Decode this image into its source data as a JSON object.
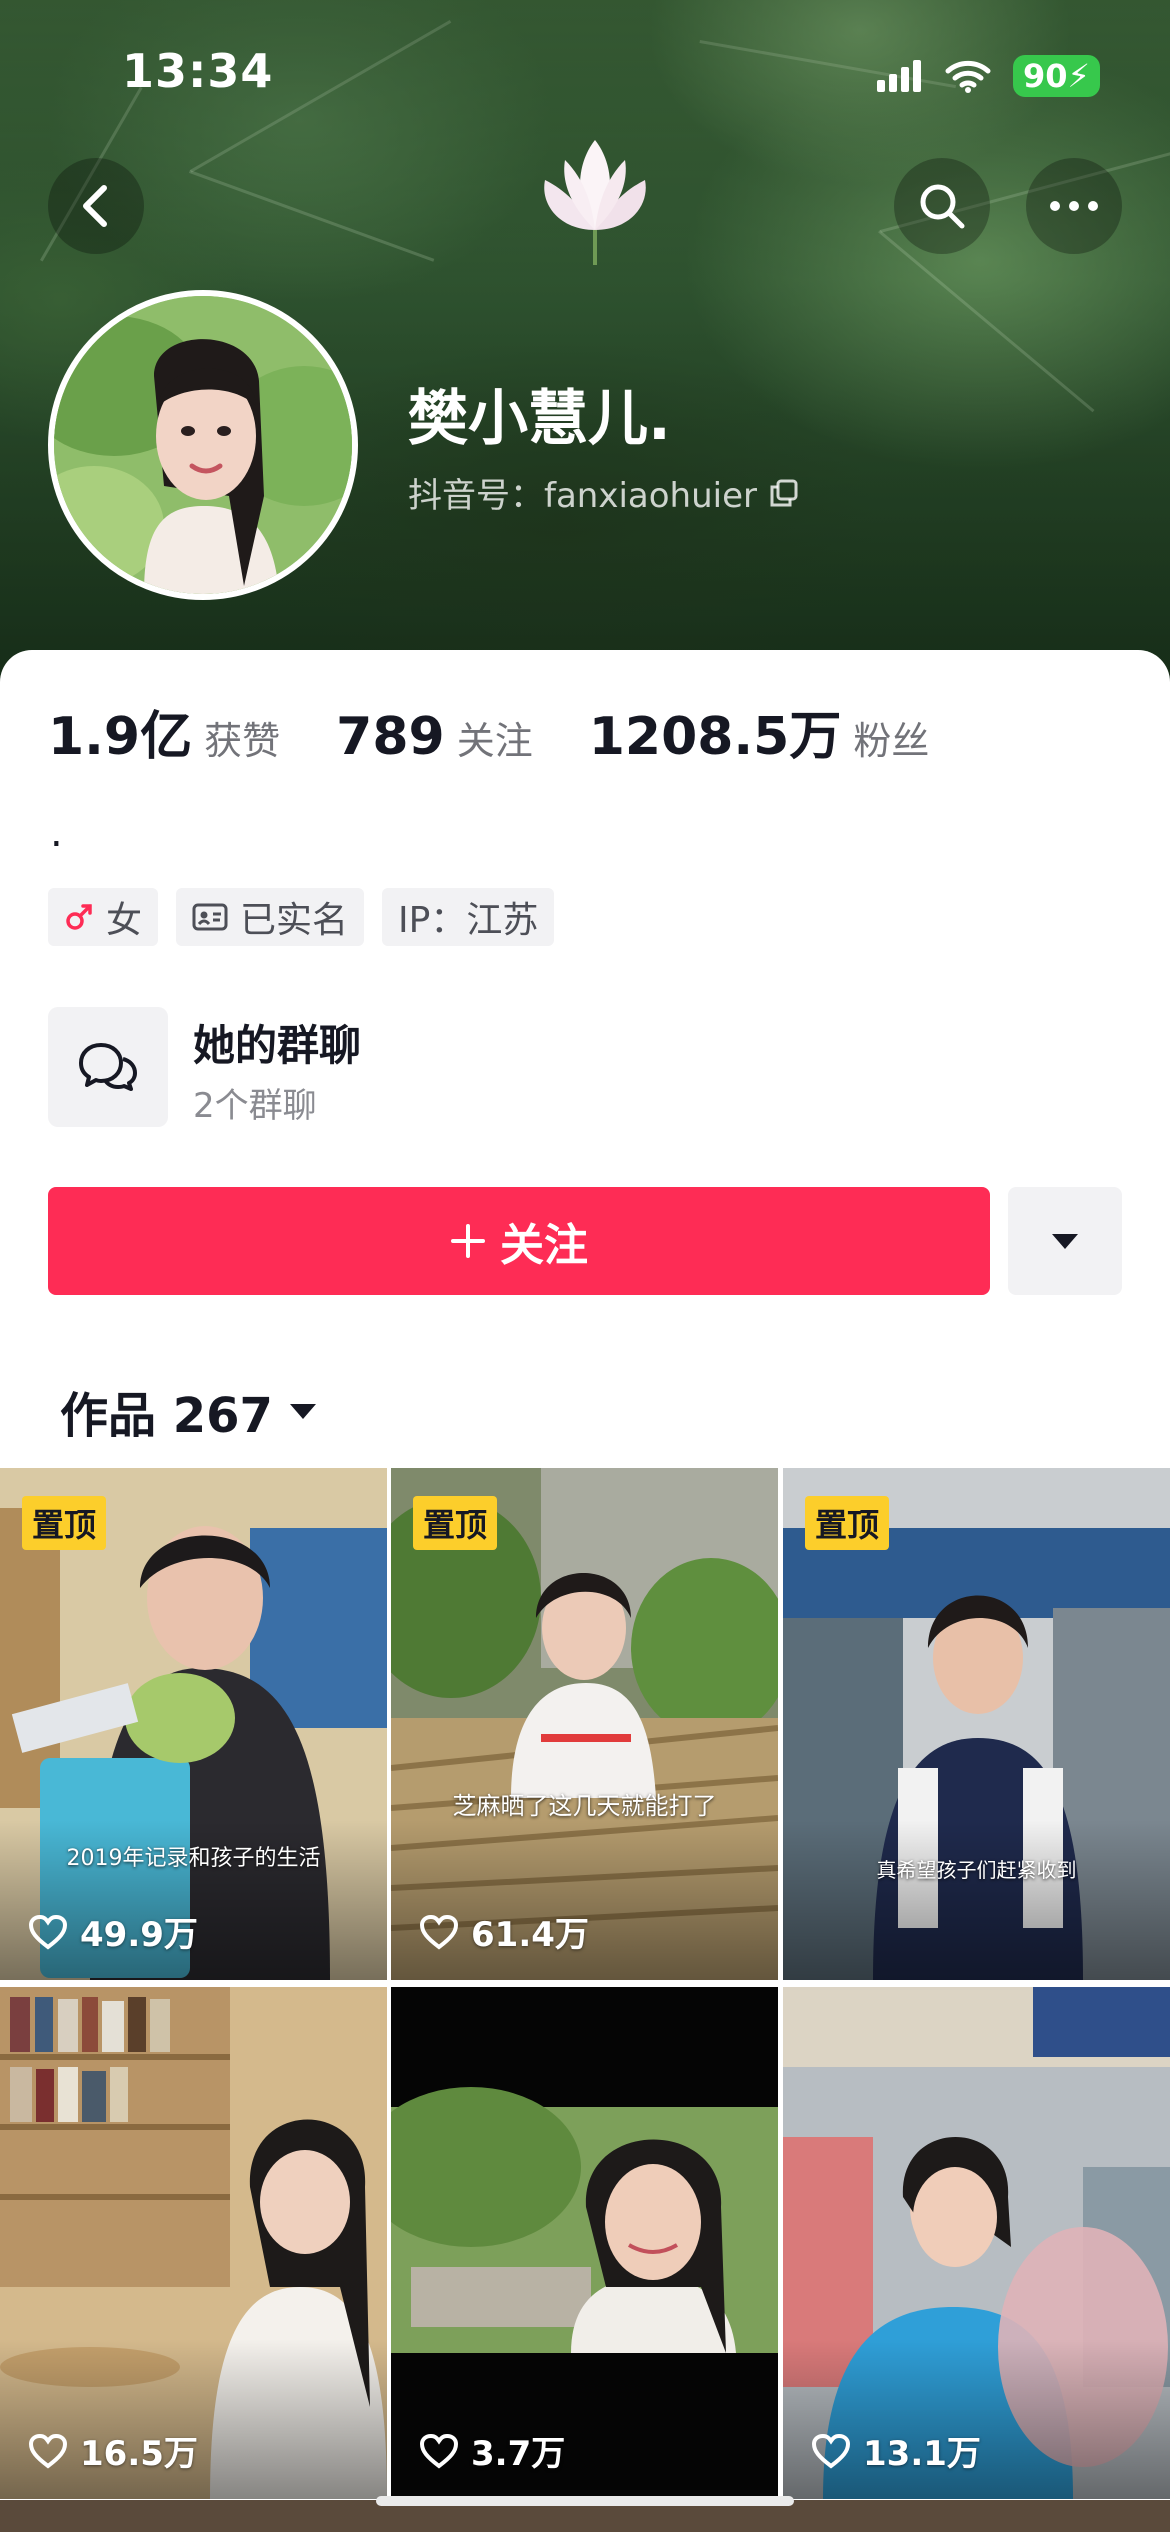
{
  "status_bar": {
    "time": "13:34",
    "battery": "90"
  },
  "profile": {
    "nickname": "樊小慧儿.",
    "douyin_id": "抖音号：fanxiaohuier",
    "bio": "."
  },
  "stats": [
    {
      "value": "1.9亿",
      "label": "获赞"
    },
    {
      "value": "789",
      "label": "关注"
    },
    {
      "value": "1208.5万",
      "label": "粉丝"
    }
  ],
  "tags": {
    "gender": "女",
    "verified": "已实名",
    "ip": "IP：江苏"
  },
  "group_chat": {
    "title": "她的群聊",
    "subtitle": "2个群聊"
  },
  "follow_button": {
    "label": "关注"
  },
  "works_tab": {
    "label": "作品 267"
  },
  "videos": [
    {
      "pinned": "置顶",
      "likes": "49.9万",
      "caption": "2019年记录和孩子的生活"
    },
    {
      "pinned": "置顶",
      "likes": "61.4万",
      "caption": "芝麻晒了这几天就能打了"
    },
    {
      "pinned": "置顶",
      "likes": "",
      "caption": "真希望孩子们赶紧收到"
    },
    {
      "pinned": "",
      "likes": "16.5万",
      "caption": ""
    },
    {
      "pinned": "",
      "likes": "3.7万",
      "caption": ""
    },
    {
      "pinned": "",
      "likes": "13.1万",
      "caption": ""
    }
  ],
  "colors": {
    "accent": "#fe2c55",
    "pin": "#fcce2b",
    "battery": "#37c84c"
  },
  "icons": [
    "back-icon",
    "search-icon",
    "more-icon",
    "copy-icon",
    "female-icon",
    "id-card-icon",
    "chat-bubbles-icon",
    "plus-icon",
    "caret-down-icon",
    "heart-icon",
    "wifi-icon",
    "signal-icon"
  ]
}
